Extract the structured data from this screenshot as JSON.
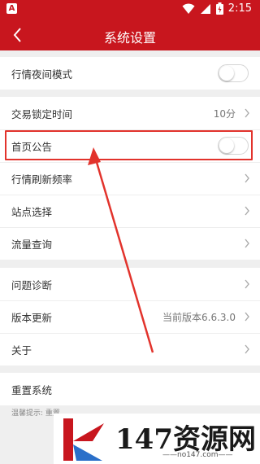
{
  "status_bar": {
    "left_icon": "A",
    "time": "2:15",
    "icons": [
      "wifi-icon",
      "signal-icon",
      "battery-icon"
    ]
  },
  "header": {
    "title": "系统设置",
    "back_icon": "chevron-left-icon"
  },
  "sections": [
    {
      "rows": [
        {
          "label": "行情夜间模式",
          "type": "toggle",
          "on": false
        }
      ]
    },
    {
      "rows": [
        {
          "label": "交易锁定时间",
          "type": "link",
          "value": "10分"
        },
        {
          "label": "首页公告",
          "type": "toggle",
          "on": false
        },
        {
          "label": "行情刷新频率",
          "type": "link"
        },
        {
          "label": "站点选择",
          "type": "link"
        },
        {
          "label": "流量查询",
          "type": "link"
        }
      ]
    },
    {
      "rows": [
        {
          "label": "问题诊断",
          "type": "link"
        },
        {
          "label": "版本更新",
          "type": "link",
          "value": "当前版本6.6.3.0"
        },
        {
          "label": "关于",
          "type": "link"
        }
      ]
    },
    {
      "rows": [
        {
          "label": "重置系统",
          "type": "plain"
        }
      ]
    }
  ],
  "hint": "温馨提示: 重置",
  "watermark": {
    "text": "147资源网",
    "url": "——no147.com——"
  },
  "colors": {
    "header_bg": "#c8161e",
    "highlight": "#e2332c",
    "page_bg": "#efefef"
  }
}
